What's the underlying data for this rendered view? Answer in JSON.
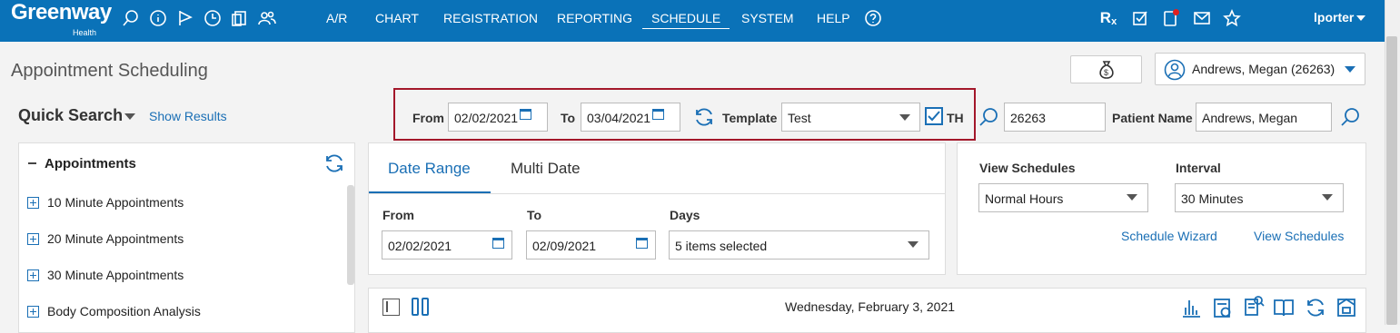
{
  "brand": {
    "name": "Greenway",
    "sub": "Health"
  },
  "nav": [
    "A/R",
    "CHART",
    "REGISTRATION",
    "REPORTING",
    "SCHEDULE",
    "SYSTEM",
    "HELP"
  ],
  "user": "lporter",
  "page_title": "Appointment Scheduling",
  "patient_selector": {
    "name": "Andrews, Megan",
    "id": "(26263)"
  },
  "quick_search": {
    "title": "Quick Search",
    "show_results": "Show Results"
  },
  "template_filter": {
    "from_label": "From",
    "from_value": "02/02/2021",
    "to_label": "To",
    "to_value": "03/04/2021",
    "template_label": "Template",
    "template_value": "Test",
    "th_label": "TH",
    "th_checked": true
  },
  "patient_search": {
    "id_value": "26263",
    "name_label": "Patient Name",
    "name_value": "Andrews, Megan"
  },
  "appointments": {
    "title": "Appointments",
    "items": [
      "10 Minute Appointments",
      "20 Minute Appointments",
      "30 Minute Appointments",
      "Body Composition Analysis"
    ]
  },
  "date_panel": {
    "tabs": [
      "Date Range",
      "Multi Date"
    ],
    "from_label": "From",
    "from_value": "02/02/2021",
    "to_label": "To",
    "to_value": "02/09/2021",
    "days_label": "Days",
    "days_value": "5 items selected"
  },
  "view_panel": {
    "view_label": "View Schedules",
    "view_value": "Normal Hours",
    "interval_label": "Interval",
    "interval_value": "30 Minutes",
    "wizard_link": "Schedule Wizard",
    "view_link": "View Schedules"
  },
  "schedule_bar": {
    "date": "Wednesday, February 3, 2021"
  },
  "colors": {
    "brand": "#0a72b8",
    "accent": "#1a6fb5",
    "highlight": "#a3172a"
  }
}
